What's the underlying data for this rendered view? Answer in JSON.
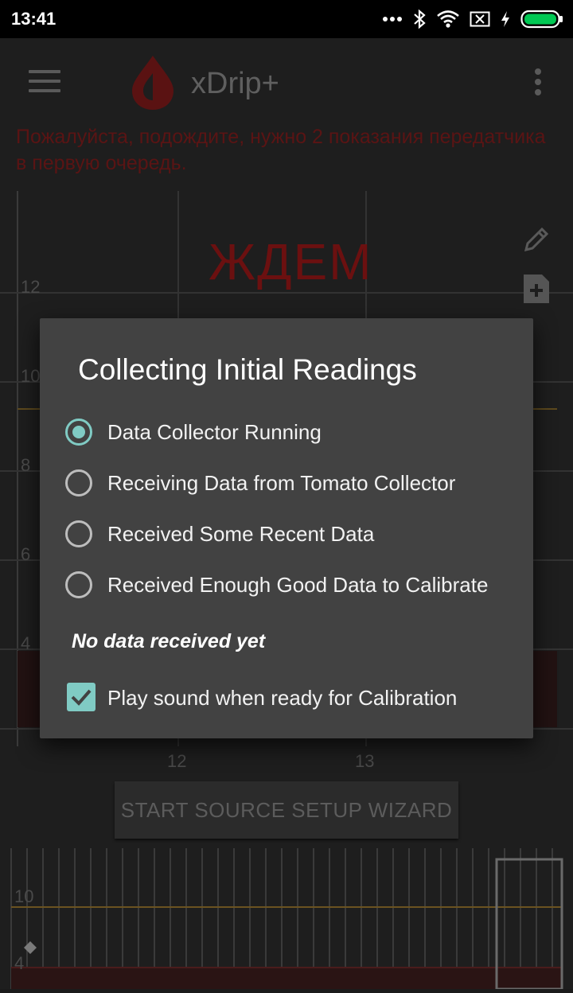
{
  "status_bar": {
    "time": "13:41",
    "icons": [
      "more-dots-icon",
      "bluetooth-icon",
      "wifi-icon",
      "sim-off-icon",
      "charging-icon",
      "battery-icon"
    ]
  },
  "toolbar": {
    "title": "xDrip+"
  },
  "notice": "Пожалуйста, подождите, нужно 2 показания передатчика в первую очередь.",
  "chart": {
    "waiting_label": "ЖДЕМ",
    "y_labels": [
      "12",
      "10",
      "8",
      "6",
      "4"
    ],
    "x_labels": [
      "12",
      "13"
    ]
  },
  "mini_chart": {
    "y_labels": [
      "10",
      "4"
    ]
  },
  "wizard_button": "START SOURCE SETUP WIZARD",
  "dialog": {
    "title": "Collecting Initial Readings",
    "options": [
      {
        "label": "Data Collector Running",
        "checked": true
      },
      {
        "label": "Receiving Data from Tomato Collector",
        "checked": false
      },
      {
        "label": "Received Some Recent Data",
        "checked": false
      },
      {
        "label": "Received Enough Good Data to Calibrate",
        "checked": false
      }
    ],
    "status": "No data received yet",
    "checkbox": {
      "label": "Play sound when ready for Calibration",
      "checked": true
    }
  },
  "colors": {
    "accent": "#80cbc4",
    "dialog_bg": "#424242",
    "alert_red": "#d32f2f",
    "target_line": "#b8860b"
  }
}
